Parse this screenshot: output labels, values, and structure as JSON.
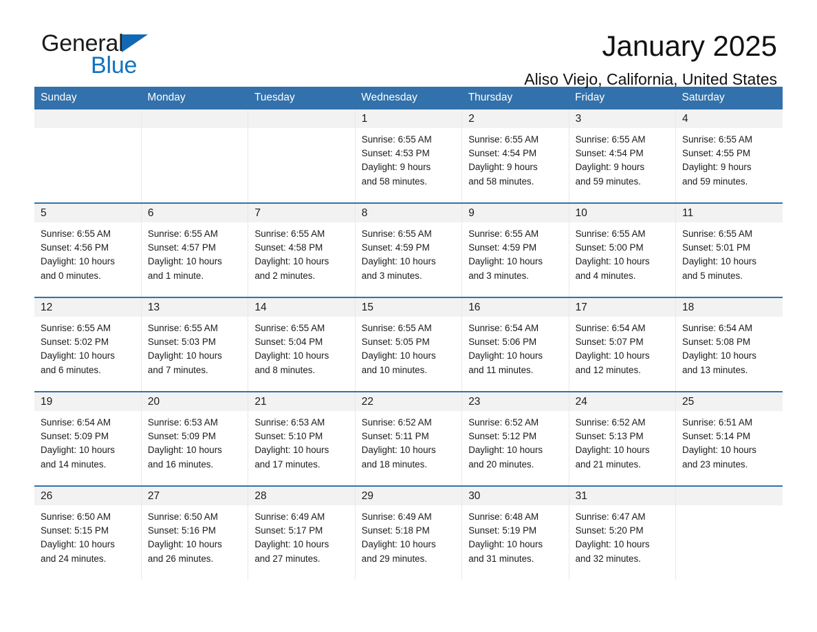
{
  "brand": {
    "name_part1": "General",
    "name_part2": "Blue",
    "triangle_icon": "triangle-icon",
    "color_blue": "#1272c0"
  },
  "header": {
    "title": "January 2025",
    "subtitle": "Aliso Viejo, California, United States"
  },
  "theme": {
    "header_bg": "#3271ab",
    "row_divider": "#3271ab",
    "daynum_band": "#f2f2f2"
  },
  "weekday_headers": [
    "Sunday",
    "Monday",
    "Tuesday",
    "Wednesday",
    "Thursday",
    "Friday",
    "Saturday"
  ],
  "weeks": [
    [
      {
        "day": "",
        "lines": [
          "",
          "",
          "",
          ""
        ]
      },
      {
        "day": "",
        "lines": [
          "",
          "",
          "",
          ""
        ]
      },
      {
        "day": "",
        "lines": [
          "",
          "",
          "",
          ""
        ]
      },
      {
        "day": "1",
        "lines": [
          "Sunrise: 6:55 AM",
          "Sunset: 4:53 PM",
          "Daylight: 9 hours",
          "and 58 minutes."
        ]
      },
      {
        "day": "2",
        "lines": [
          "Sunrise: 6:55 AM",
          "Sunset: 4:54 PM",
          "Daylight: 9 hours",
          "and 58 minutes."
        ]
      },
      {
        "day": "3",
        "lines": [
          "Sunrise: 6:55 AM",
          "Sunset: 4:54 PM",
          "Daylight: 9 hours",
          "and 59 minutes."
        ]
      },
      {
        "day": "4",
        "lines": [
          "Sunrise: 6:55 AM",
          "Sunset: 4:55 PM",
          "Daylight: 9 hours",
          "and 59 minutes."
        ]
      }
    ],
    [
      {
        "day": "5",
        "lines": [
          "Sunrise: 6:55 AM",
          "Sunset: 4:56 PM",
          "Daylight: 10 hours",
          "and 0 minutes."
        ]
      },
      {
        "day": "6",
        "lines": [
          "Sunrise: 6:55 AM",
          "Sunset: 4:57 PM",
          "Daylight: 10 hours",
          "and 1 minute."
        ]
      },
      {
        "day": "7",
        "lines": [
          "Sunrise: 6:55 AM",
          "Sunset: 4:58 PM",
          "Daylight: 10 hours",
          "and 2 minutes."
        ]
      },
      {
        "day": "8",
        "lines": [
          "Sunrise: 6:55 AM",
          "Sunset: 4:59 PM",
          "Daylight: 10 hours",
          "and 3 minutes."
        ]
      },
      {
        "day": "9",
        "lines": [
          "Sunrise: 6:55 AM",
          "Sunset: 4:59 PM",
          "Daylight: 10 hours",
          "and 3 minutes."
        ]
      },
      {
        "day": "10",
        "lines": [
          "Sunrise: 6:55 AM",
          "Sunset: 5:00 PM",
          "Daylight: 10 hours",
          "and 4 minutes."
        ]
      },
      {
        "day": "11",
        "lines": [
          "Sunrise: 6:55 AM",
          "Sunset: 5:01 PM",
          "Daylight: 10 hours",
          "and 5 minutes."
        ]
      }
    ],
    [
      {
        "day": "12",
        "lines": [
          "Sunrise: 6:55 AM",
          "Sunset: 5:02 PM",
          "Daylight: 10 hours",
          "and 6 minutes."
        ]
      },
      {
        "day": "13",
        "lines": [
          "Sunrise: 6:55 AM",
          "Sunset: 5:03 PM",
          "Daylight: 10 hours",
          "and 7 minutes."
        ]
      },
      {
        "day": "14",
        "lines": [
          "Sunrise: 6:55 AM",
          "Sunset: 5:04 PM",
          "Daylight: 10 hours",
          "and 8 minutes."
        ]
      },
      {
        "day": "15",
        "lines": [
          "Sunrise: 6:55 AM",
          "Sunset: 5:05 PM",
          "Daylight: 10 hours",
          "and 10 minutes."
        ]
      },
      {
        "day": "16",
        "lines": [
          "Sunrise: 6:54 AM",
          "Sunset: 5:06 PM",
          "Daylight: 10 hours",
          "and 11 minutes."
        ]
      },
      {
        "day": "17",
        "lines": [
          "Sunrise: 6:54 AM",
          "Sunset: 5:07 PM",
          "Daylight: 10 hours",
          "and 12 minutes."
        ]
      },
      {
        "day": "18",
        "lines": [
          "Sunrise: 6:54 AM",
          "Sunset: 5:08 PM",
          "Daylight: 10 hours",
          "and 13 minutes."
        ]
      }
    ],
    [
      {
        "day": "19",
        "lines": [
          "Sunrise: 6:54 AM",
          "Sunset: 5:09 PM",
          "Daylight: 10 hours",
          "and 14 minutes."
        ]
      },
      {
        "day": "20",
        "lines": [
          "Sunrise: 6:53 AM",
          "Sunset: 5:09 PM",
          "Daylight: 10 hours",
          "and 16 minutes."
        ]
      },
      {
        "day": "21",
        "lines": [
          "Sunrise: 6:53 AM",
          "Sunset: 5:10 PM",
          "Daylight: 10 hours",
          "and 17 minutes."
        ]
      },
      {
        "day": "22",
        "lines": [
          "Sunrise: 6:52 AM",
          "Sunset: 5:11 PM",
          "Daylight: 10 hours",
          "and 18 minutes."
        ]
      },
      {
        "day": "23",
        "lines": [
          "Sunrise: 6:52 AM",
          "Sunset: 5:12 PM",
          "Daylight: 10 hours",
          "and 20 minutes."
        ]
      },
      {
        "day": "24",
        "lines": [
          "Sunrise: 6:52 AM",
          "Sunset: 5:13 PM",
          "Daylight: 10 hours",
          "and 21 minutes."
        ]
      },
      {
        "day": "25",
        "lines": [
          "Sunrise: 6:51 AM",
          "Sunset: 5:14 PM",
          "Daylight: 10 hours",
          "and 23 minutes."
        ]
      }
    ],
    [
      {
        "day": "26",
        "lines": [
          "Sunrise: 6:50 AM",
          "Sunset: 5:15 PM",
          "Daylight: 10 hours",
          "and 24 minutes."
        ]
      },
      {
        "day": "27",
        "lines": [
          "Sunrise: 6:50 AM",
          "Sunset: 5:16 PM",
          "Daylight: 10 hours",
          "and 26 minutes."
        ]
      },
      {
        "day": "28",
        "lines": [
          "Sunrise: 6:49 AM",
          "Sunset: 5:17 PM",
          "Daylight: 10 hours",
          "and 27 minutes."
        ]
      },
      {
        "day": "29",
        "lines": [
          "Sunrise: 6:49 AM",
          "Sunset: 5:18 PM",
          "Daylight: 10 hours",
          "and 29 minutes."
        ]
      },
      {
        "day": "30",
        "lines": [
          "Sunrise: 6:48 AM",
          "Sunset: 5:19 PM",
          "Daylight: 10 hours",
          "and 31 minutes."
        ]
      },
      {
        "day": "31",
        "lines": [
          "Sunrise: 6:47 AM",
          "Sunset: 5:20 PM",
          "Daylight: 10 hours",
          "and 32 minutes."
        ]
      },
      {
        "day": "",
        "lines": [
          "",
          "",
          "",
          ""
        ]
      }
    ]
  ]
}
